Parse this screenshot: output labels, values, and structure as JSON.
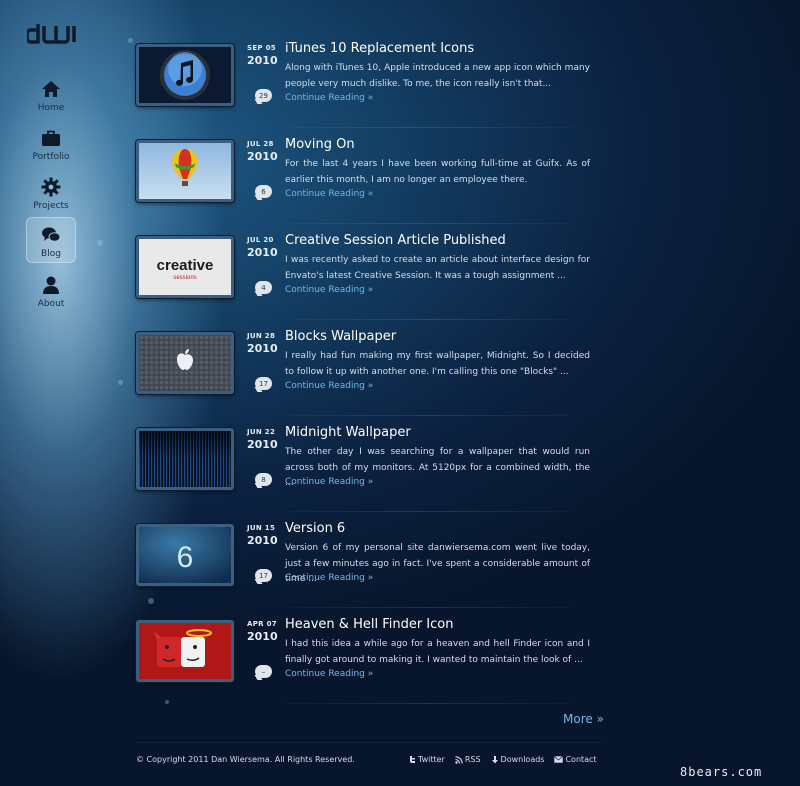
{
  "site": {
    "logo_text": "dW",
    "nav": [
      {
        "label": "Home",
        "icon": "home-icon"
      },
      {
        "label": "Portfolio",
        "icon": "briefcase-icon"
      },
      {
        "label": "Projects",
        "icon": "gear-icon"
      },
      {
        "label": "Blog",
        "icon": "chat-bubbles-icon",
        "active": true
      },
      {
        "label": "About",
        "icon": "person-icon"
      }
    ]
  },
  "posts": [
    {
      "month_day": "SEP 05",
      "year": "2010",
      "title": "iTunes 10 Replacement Icons",
      "excerpt": "Along with iTunes 10, Apple introduced a new app icon which many people very much dislike. To me, the icon really isn't that...",
      "read_more": "Continue Reading »",
      "comments": "29",
      "thumb": "itunes-icon-thumbnail"
    },
    {
      "month_day": "JUL 28",
      "year": "2010",
      "title": "Moving On",
      "excerpt": "For the last 4 years I have been working full-time at Guifx. As of earlier this month, I am no longer an employee there.",
      "read_more": "Continue Reading »",
      "comments": "6",
      "thumb": "hot-air-balloon-thumbnail"
    },
    {
      "month_day": "JUL 20",
      "year": "2010",
      "title": "Creative Session Article Published",
      "excerpt": "I was recently asked to create an article about interface design for Envato's latest Creative Session. It was a tough assignment ...",
      "read_more": "Continue Reading »",
      "comments": "4",
      "thumb": "creative-sessions-thumbnail",
      "thumb_text": "creative",
      "thumb_subtext": "sessions"
    },
    {
      "month_day": "JUN 28",
      "year": "2010",
      "title": "Blocks Wallpaper",
      "excerpt": "I really had fun making my first wallpaper, Midnight. So I decided to follow it up with another one. I'm calling this one \"Blocks\" ...",
      "read_more": "Continue Reading »",
      "comments": "17",
      "thumb": "apple-blocks-thumbnail"
    },
    {
      "month_day": "JUN 22",
      "year": "2010",
      "title": "Midnight Wallpaper",
      "excerpt": "The other day I was searching for a wallpaper that would run across both of my monitors. At 5120px for a combined width, the ...",
      "read_more": "Continue Reading »",
      "comments": "8",
      "thumb": "midnight-wallpaper-thumbnail"
    },
    {
      "month_day": "JUN 15",
      "year": "2010",
      "title": "Version 6",
      "excerpt": "Version 6 of my personal site danwiersema.com went live today, just a few minutes ago in fact. I've spent a considerable amount of time ...",
      "read_more": "Continue Reading »",
      "comments": "17",
      "thumb": "version-6-thumbnail",
      "thumb_text": "6"
    },
    {
      "month_day": "APR 07",
      "year": "2010",
      "title": "Heaven & Hell Finder Icon",
      "excerpt": "I had this idea a while ago for a heaven and hell Finder icon and I finally got around to making it. I wanted to maintain the look of ...",
      "read_more": "Continue Reading »",
      "comments": "–",
      "thumb": "finder-icon-thumbnail"
    }
  ],
  "more_label": "More »",
  "footer": {
    "copyright": "© Copyright 2011 Dan Wiersema. All Rights Reserved.",
    "links": [
      {
        "label": "Twitter",
        "icon": "twitter-icon"
      },
      {
        "label": "RSS",
        "icon": "rss-icon"
      },
      {
        "label": "Downloads",
        "icon": "download-icon"
      },
      {
        "label": "Contact",
        "icon": "mail-icon"
      }
    ]
  },
  "watermark": "8bears.com"
}
